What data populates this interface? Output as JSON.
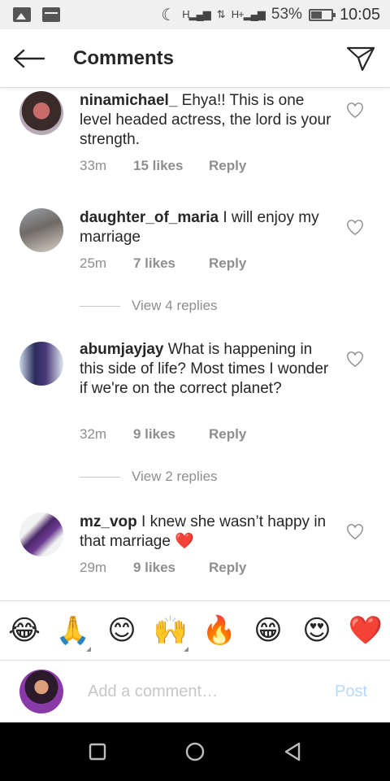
{
  "status_bar": {
    "battery_percent": "53%",
    "battery_level": 0.53,
    "time": "10:05",
    "network_label_1": "H",
    "network_label_2": "H+"
  },
  "header": {
    "title": "Comments",
    "back_icon": "arrow-left-icon",
    "share_icon": "paper-plane-icon"
  },
  "comments": [
    {
      "username": "ninamichael_",
      "text": " Ehya!! This is one level headed actress, the lord is your strength.",
      "age": "33m",
      "likes": "15 likes",
      "reply": "Reply"
    },
    {
      "username": "daughter_of_maria",
      "text": " I will enjoy my marriage",
      "age": "25m",
      "likes": "7 likes",
      "reply": "Reply",
      "view_replies": "View 4 replies"
    },
    {
      "username": "abumjayjay",
      "text": " What is happening in this side of life? Most times I wonder if we're on the correct planet?",
      "age": "32m",
      "likes": "9 likes",
      "reply": "Reply",
      "view_replies": "View 2 replies"
    },
    {
      "username": "mz_vop",
      "text": " I knew she wasn’t happy in that marriage ❤️",
      "age": "29m",
      "likes": "9 likes",
      "reply": "Reply"
    }
  ],
  "emoji_bar": [
    "😂",
    "🙏",
    "😊",
    "🙌",
    "🔥",
    "😁",
    "😍",
    "❤️"
  ],
  "composer": {
    "placeholder": "Add a comment…",
    "post_label": "Post"
  },
  "colors": {
    "accent_disabled": "#b3dbff",
    "secondary_text": "#8e8e8e",
    "heart": "#ed4956"
  }
}
